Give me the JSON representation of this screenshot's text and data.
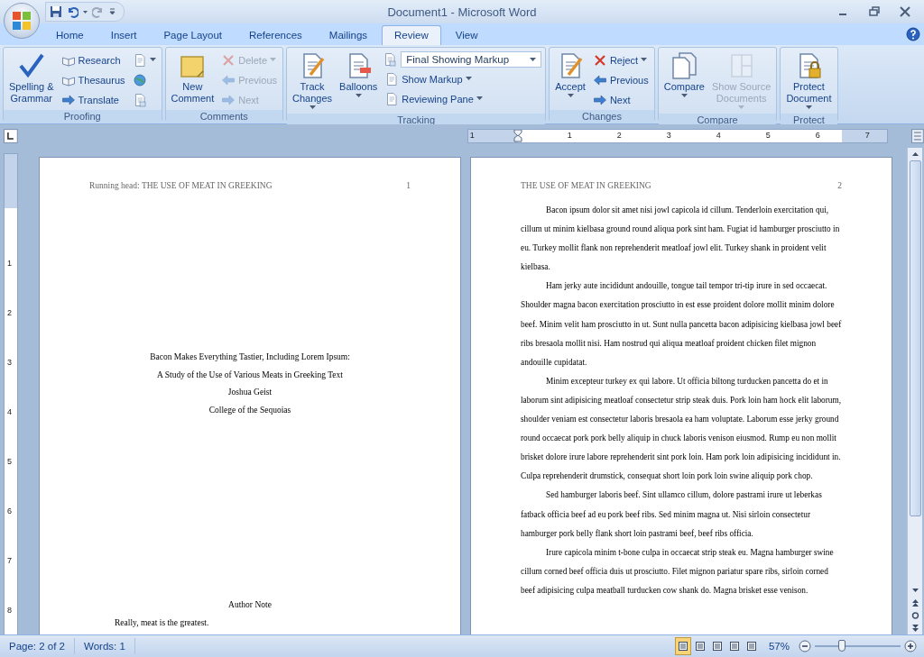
{
  "window": {
    "title": "Document1 - Microsoft Word"
  },
  "tabs": [
    {
      "label": "Home",
      "selected": false
    },
    {
      "label": "Insert",
      "selected": false
    },
    {
      "label": "Page Layout",
      "selected": false
    },
    {
      "label": "References",
      "selected": false
    },
    {
      "label": "Mailings",
      "selected": false
    },
    {
      "label": "Review",
      "selected": true
    },
    {
      "label": "View",
      "selected": false
    }
  ],
  "ribbon": {
    "groups": [
      {
        "label": "Proofing",
        "items": [
          {
            "kind": "large",
            "label": "Spelling &\nGrammar",
            "dropdown": false,
            "disabled": false
          },
          {
            "kind": "stack",
            "buttons": [
              {
                "kind": "button",
                "label": "Research",
                "dropdown": false,
                "disabled": false
              },
              {
                "kind": "button",
                "label": "Thesaurus",
                "dropdown": false,
                "disabled": false
              },
              {
                "kind": "button",
                "label": "Translate",
                "dropdown": false,
                "disabled": false
              }
            ]
          },
          {
            "kind": "stack",
            "buttons": [
              {
                "kind": "button",
                "dropdown": true,
                "disabled": false
              },
              {
                "kind": "button",
                "dropdown": false,
                "disabled": false
              },
              {
                "kind": "button",
                "dropdown": false,
                "disabled": false
              }
            ]
          }
        ]
      },
      {
        "label": "Comments",
        "items": [
          {
            "kind": "large",
            "label": "New\nComment",
            "dropdown": false,
            "disabled": false
          },
          {
            "kind": "stack",
            "buttons": [
              {
                "kind": "button",
                "label": "Delete",
                "dropdown": true,
                "disabled": true
              },
              {
                "kind": "button",
                "label": "Previous",
                "dropdown": false,
                "disabled": true
              },
              {
                "kind": "button",
                "label": "Next",
                "dropdown": false,
                "disabled": true
              }
            ]
          }
        ]
      },
      {
        "label": "Tracking",
        "items": [
          {
            "kind": "large",
            "label": "Track\nChanges",
            "dropdown": true,
            "disabled": false
          },
          {
            "kind": "large",
            "label": "Balloons",
            "dropdown": true,
            "disabled": false
          },
          {
            "kind": "stack",
            "buttons": [
              {
                "kind": "select",
                "value": "Final Showing Markup"
              },
              {
                "kind": "button",
                "label": "Show Markup",
                "dropdown": true,
                "disabled": false
              },
              {
                "kind": "button",
                "label": "Reviewing Pane",
                "dropdown": true,
                "disabled": false
              }
            ]
          }
        ]
      },
      {
        "label": "Changes",
        "items": [
          {
            "kind": "large",
            "label": "Accept",
            "dropdown": true,
            "disabled": false
          },
          {
            "kind": "stack",
            "buttons": [
              {
                "kind": "button",
                "label": "Reject",
                "dropdown": true,
                "disabled": false
              },
              {
                "kind": "button",
                "label": "Previous",
                "dropdown": false,
                "disabled": false
              },
              {
                "kind": "button",
                "label": "Next",
                "dropdown": false,
                "disabled": false
              }
            ]
          }
        ]
      },
      {
        "label": "Compare",
        "items": [
          {
            "kind": "large",
            "label": "Compare",
            "dropdown": true,
            "disabled": false
          },
          {
            "kind": "large",
            "label": "Show Source\nDocuments",
            "dropdown": true,
            "disabled": true
          }
        ]
      },
      {
        "label": "Protect",
        "items": [
          {
            "kind": "large",
            "label": "Protect\nDocument",
            "dropdown": true,
            "disabled": false
          }
        ]
      }
    ]
  },
  "ruler": {
    "horizontal": [
      "1",
      "1",
      "2",
      "3",
      "4",
      "5",
      "6",
      "7"
    ],
    "vertical": [
      "1",
      "2",
      "3",
      "4",
      "5",
      "6",
      "7",
      "8"
    ]
  },
  "pages": [
    {
      "header": "Running head: THE USE OF MEAT IN GREEKING",
      "page_number": "1",
      "title_lines": [
        "Bacon Makes Everything Tastier, Including Lorem Ipsum:",
        "A Study of the Use of Various Meats in Greeking Text",
        "Joshua Geist",
        "College of the Sequoias"
      ],
      "note_heading": "Author Note",
      "note_text": "Really, meat is the greatest."
    },
    {
      "header": "THE USE OF MEAT IN GREEKING",
      "page_number": "2",
      "paragraphs": [
        "Bacon ipsum dolor sit amet nisi jowl capicola id cillum. Tenderloin exercitation qui, cillum ut minim kielbasa ground round aliqua pork sint ham. Fugiat id hamburger prosciutto in eu. Turkey mollit flank non reprehenderit meatloaf jowl elit. Turkey shank in proident velit kielbasa.",
        "Ham jerky aute incididunt andouille, tongue tail tempor tri-tip irure in sed occaecat. Shoulder magna bacon exercitation prosciutto in est esse proident dolore mollit minim dolore beef. Minim velit ham prosciutto in ut. Sunt nulla pancetta bacon adipisicing kielbasa jowl beef ribs bresaola mollit nisi. Ham nostrud qui aliqua meatloaf proident chicken filet mignon andouille cupidatat.",
        "Minim excepteur turkey ex qui labore. Ut officia biltong turducken pancetta do et in laborum sint adipisicing meatloaf consectetur strip steak duis. Pork loin ham hock elit laborum, shoulder veniam est consectetur laboris bresaola ea ham voluptate. Laborum esse jerky ground round occaecat pork pork belly aliquip in chuck laboris venison eiusmod. Rump eu non mollit brisket dolore irure labore reprehenderit sint pork loin. Ham pork loin adipisicing incididunt in. Culpa reprehenderit drumstick, consequat short loin pork loin swine aliquip pork chop.",
        "Sed hamburger laboris beef. Sint ullamco cillum, dolore pastrami irure ut leberkas fatback officia beef ad eu pork beef ribs. Sed minim magna ut. Nisi sirloin consectetur hamburger pork belly flank short loin pastrami beef, beef ribs officia.",
        "Irure capicola minim t-bone culpa in occaecat strip steak eu. Magna hamburger swine cillum corned beef officia duis ut prosciutto. Filet mignon pariatur spare ribs, sirloin corned beef adipisicing culpa meatball turducken cow shank do. Magna brisket esse venison."
      ]
    }
  ],
  "status_bar": {
    "page": "Page: 2 of 2",
    "words": "Words: 1",
    "views": [
      {
        "selected": true
      },
      {
        "selected": false
      },
      {
        "selected": false
      },
      {
        "selected": false
      },
      {
        "selected": false
      }
    ],
    "zoom": "57%",
    "zoom_slider": {
      "level": 0.32
    }
  }
}
